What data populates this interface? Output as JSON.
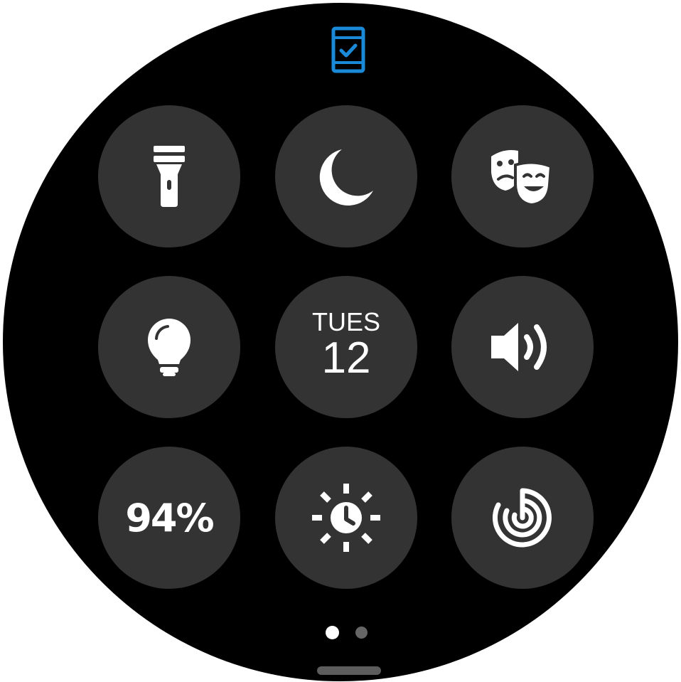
{
  "status": {
    "top_icon": "phone-checkmark-icon",
    "accent_color": "#1a8ad8"
  },
  "quick_settings": {
    "tiles": [
      {
        "id": "flashlight",
        "icon": "flashlight-icon"
      },
      {
        "id": "do_not_disturb",
        "icon": "moon-icon"
      },
      {
        "id": "theater_mode",
        "icon": "theater-masks-icon"
      },
      {
        "id": "always_on_display",
        "icon": "lightbulb-icon"
      },
      {
        "id": "date",
        "day_label": "TUES",
        "day_number": "12"
      },
      {
        "id": "sound",
        "icon": "speaker-volume-icon"
      },
      {
        "id": "battery",
        "battery_label": "94%"
      },
      {
        "id": "brightness",
        "icon": "sun-clock-icon"
      },
      {
        "id": "find_my_phone",
        "icon": "radar-icon"
      }
    ],
    "tile_color": "#333333"
  },
  "pagination": {
    "pages": 2,
    "current_page": 1
  }
}
